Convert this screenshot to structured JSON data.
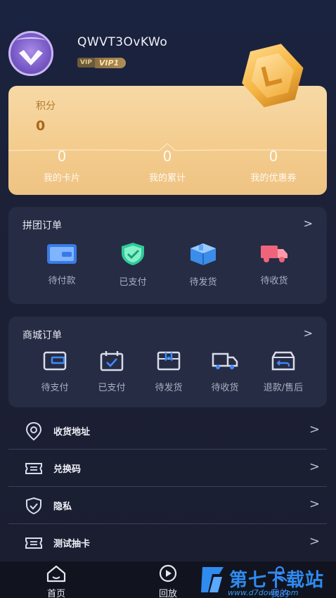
{
  "profile": {
    "username": "QWVT3OvKWo",
    "vip_tag": "VIP",
    "vip_level": "VIP1"
  },
  "points": {
    "label": "积分",
    "value": "0",
    "stats": [
      {
        "value": "0",
        "label": "我的卡片"
      },
      {
        "value": "0",
        "label": "我的累计"
      },
      {
        "value": "0",
        "label": "我的优惠券"
      }
    ]
  },
  "group_orders": {
    "title": "拼团订单",
    "arrow": ">",
    "items": [
      {
        "label": "待付款",
        "icon": "card-icon"
      },
      {
        "label": "已支付",
        "icon": "shield-check-icon"
      },
      {
        "label": "待发货",
        "icon": "box-icon"
      },
      {
        "label": "待收货",
        "icon": "truck-icon"
      }
    ]
  },
  "mall_orders": {
    "title": "商城订单",
    "arrow": ">",
    "items": [
      {
        "label": "待支付",
        "icon": "wallet-icon"
      },
      {
        "label": "已支付",
        "icon": "calendar-check-icon"
      },
      {
        "label": "待发货",
        "icon": "package-icon"
      },
      {
        "label": "待收货",
        "icon": "truck-icon"
      },
      {
        "label": "退款/售后",
        "icon": "return-box-icon"
      }
    ]
  },
  "menu": [
    {
      "label": "收货地址",
      "icon": "location-icon",
      "arrow": ">"
    },
    {
      "label": "兑换码",
      "icon": "ticket-icon",
      "arrow": ">"
    },
    {
      "label": "隐私",
      "icon": "shield-icon",
      "arrow": ">"
    },
    {
      "label": "测试抽卡",
      "icon": "ticket-icon",
      "arrow": ">"
    }
  ],
  "tabbar": {
    "items": [
      {
        "label": "首页",
        "icon": "home-icon"
      },
      {
        "label": "回放",
        "icon": "play-icon"
      },
      {
        "label": "我的",
        "icon": "user-icon"
      }
    ]
  },
  "watermark": {
    "text": "第七下载站",
    "sub": "www.d7down.com"
  },
  "colors": {
    "accent_gold": "#f3cb8c",
    "panel": "#262c43",
    "tab_active": "#3d8bff"
  }
}
